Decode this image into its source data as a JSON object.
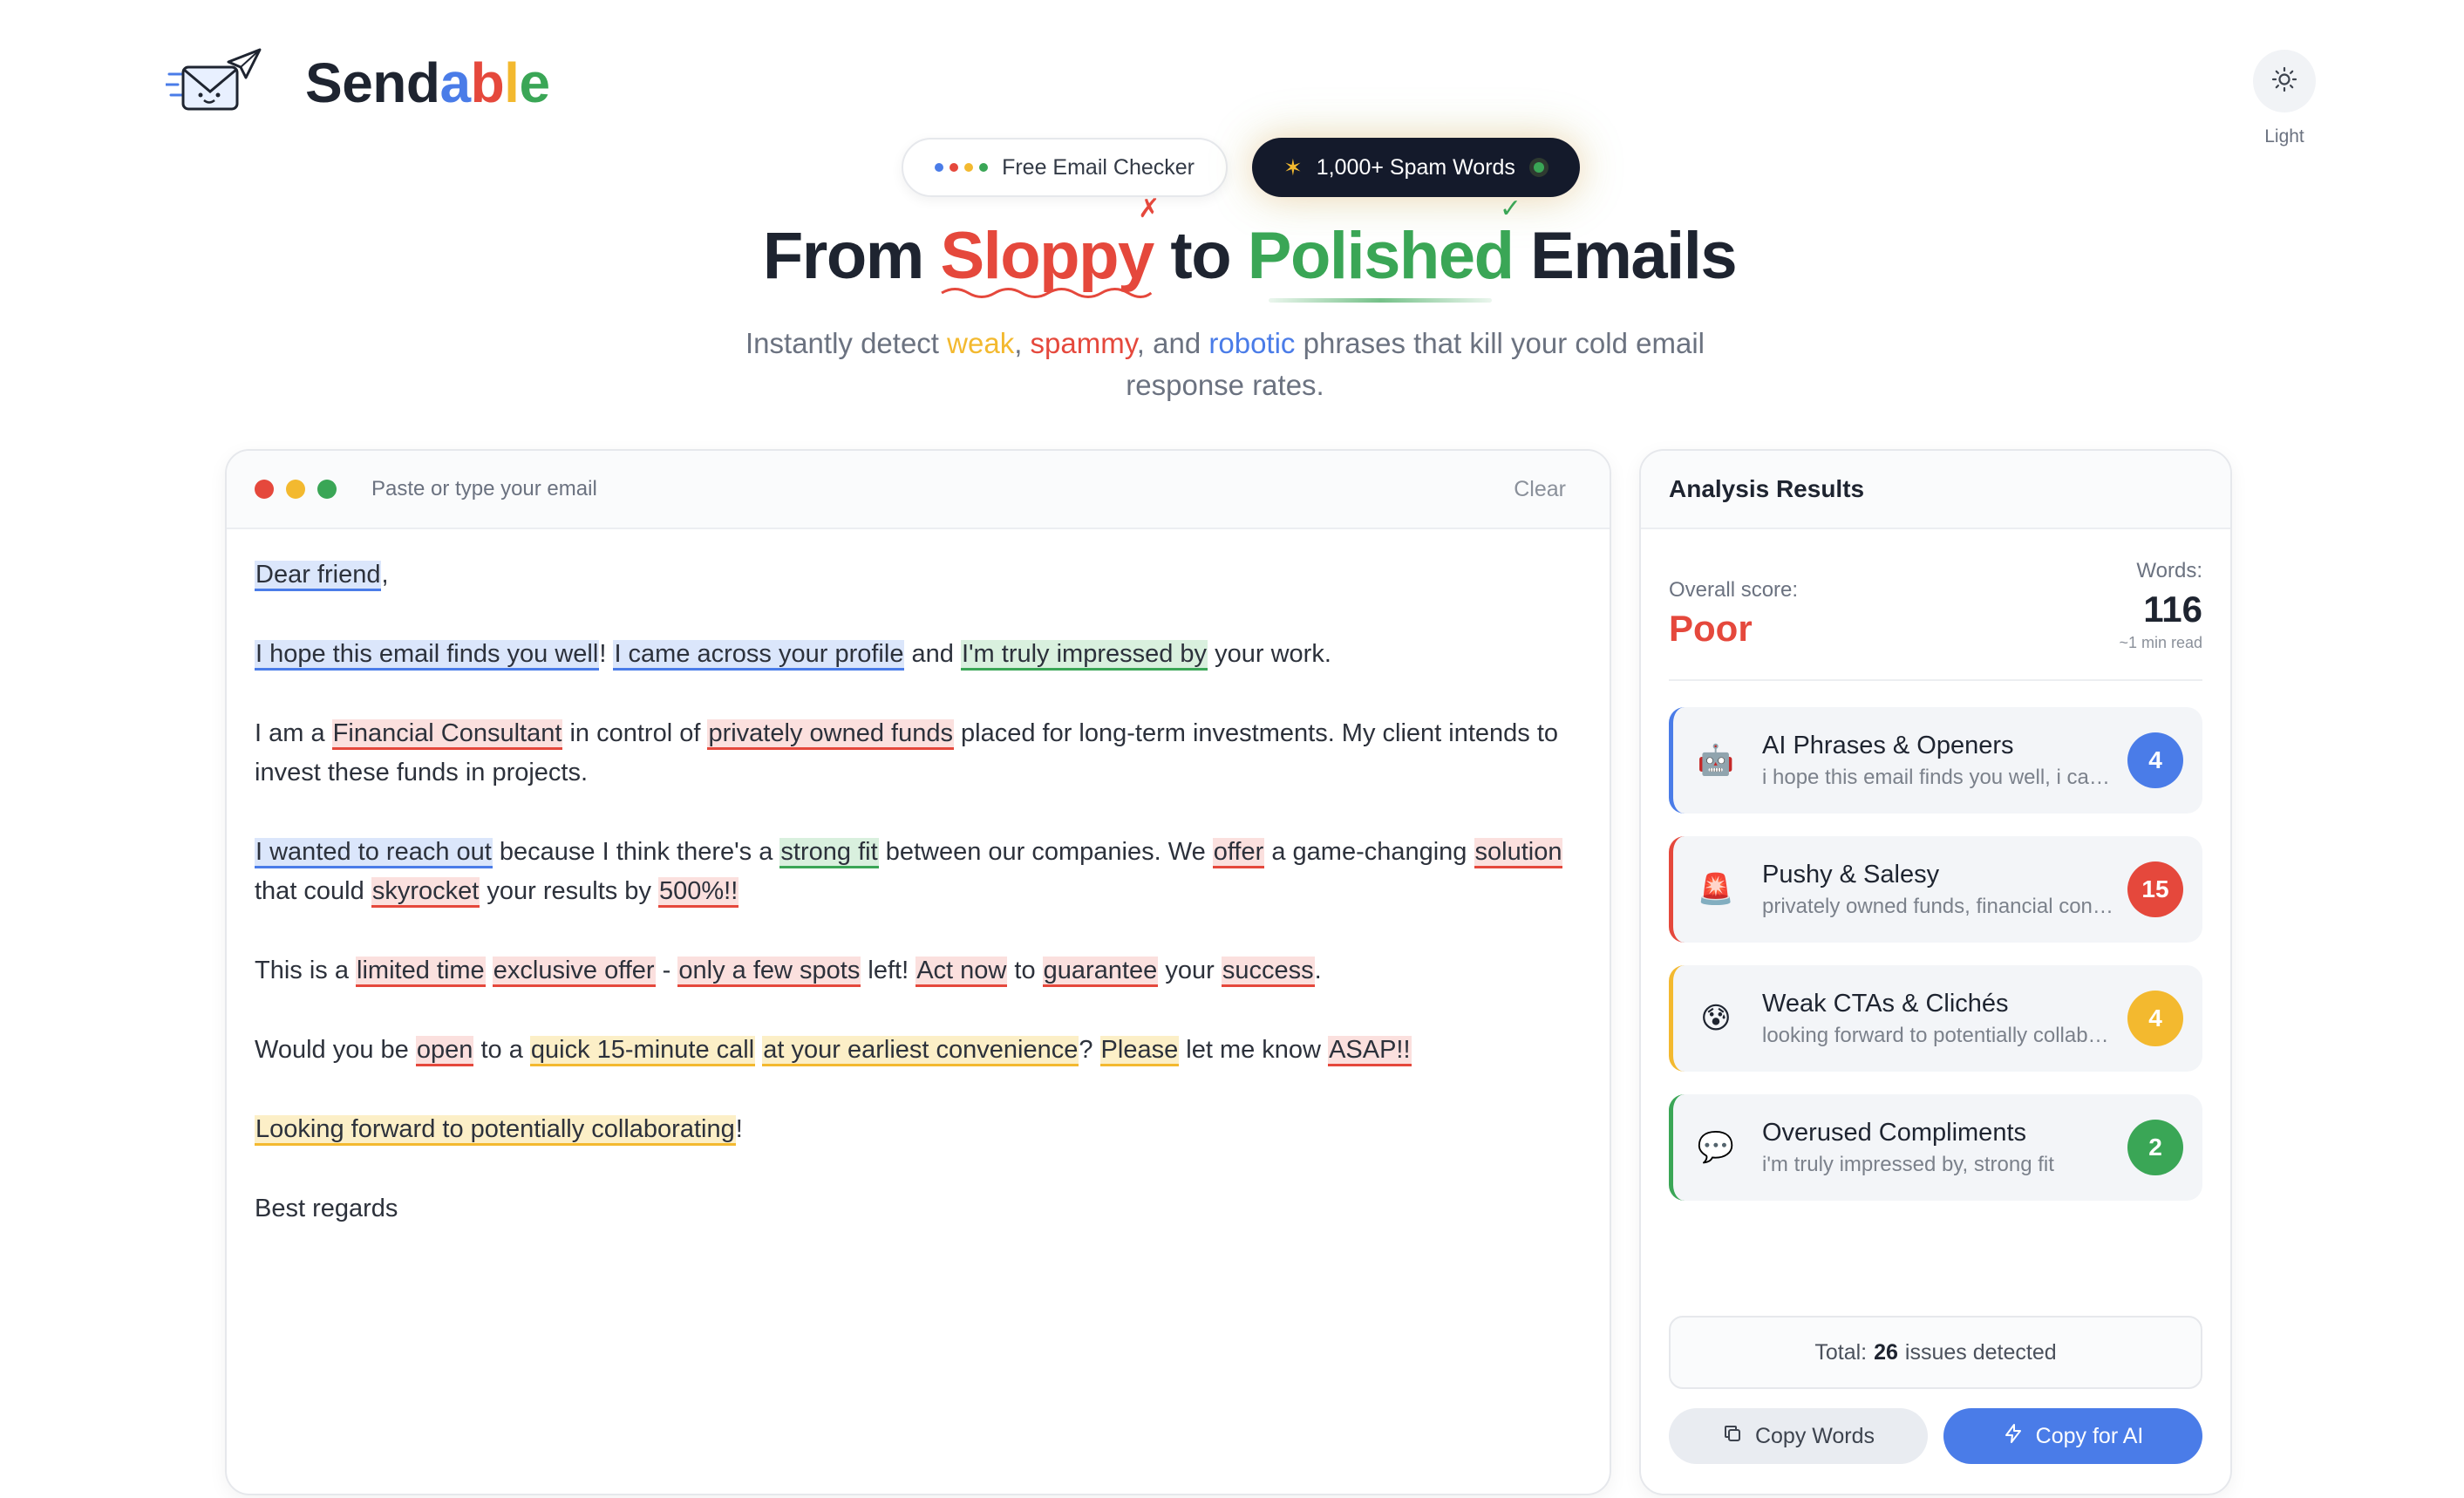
{
  "brand": {
    "part1": "Send",
    "a": "a",
    "b": "b",
    "l": "l",
    "e": "e"
  },
  "theme": {
    "label": "Light"
  },
  "pills": {
    "free_checker": "Free Email Checker",
    "spam_words": "1,000+ Spam Words",
    "spam_star": "✶"
  },
  "hero": {
    "from": "From",
    "sloppy": "Sloppy",
    "to": "to",
    "polished": "Polished",
    "emails": "Emails",
    "sub_1": "Instantly detect",
    "weak": "weak",
    "comma": ",",
    "spammy": "spammy",
    "and": ", and",
    "robotic": "robotic",
    "sub_2": "phrases that kill your cold email response rates."
  },
  "editor": {
    "placeholder": "Paste or type your email",
    "clear_label": "Clear",
    "p1": {
      "t1": "Dear friend",
      "t2": ","
    },
    "p2": {
      "t1": "I hope this email finds you well",
      "t2": "! ",
      "t3": "I came across your profile",
      "t4": " and ",
      "t5": "I'm truly impressed by",
      "t6": " your work."
    },
    "p3": {
      "t1": "I am a ",
      "t2": "Financial Consultant",
      "t3": " in control of ",
      "t4": "privately owned funds",
      "t5": " placed for long-term investments. My client intends to invest these funds in projects."
    },
    "p4": {
      "t1": "I wanted to reach out",
      "t2": " because I think there's a ",
      "t3": "strong fit",
      "t4": " between our companies. We ",
      "t5": "offer",
      "t6": " a game-changing ",
      "t7": "solution",
      "t8": " that could ",
      "t9": "skyrocket",
      "t10": " your results by ",
      "t11": "500%!!"
    },
    "p5": {
      "t1": "This is a ",
      "t2": "limited time",
      "t3": " ",
      "t4": "exclusive offer",
      "t5": " - ",
      "t6": "only a few spots",
      "t7": " left! ",
      "t8": "Act now",
      "t9": " to ",
      "t10": "guarantee",
      "t11": " your ",
      "t12": "success",
      "t13": "."
    },
    "p6": {
      "t1": "Would you be ",
      "t2": "open",
      "t3": " to a ",
      "t4": "quick 15-minute call",
      "t5": " ",
      "t6": "at your earliest convenience",
      "t7": "? ",
      "t8": "Please",
      "t9": " let me know ",
      "t10": "ASAP!!"
    },
    "p7": {
      "t1": "Looking forward to potentially collaborating",
      "t2": "!"
    },
    "p8": {
      "t1": "Best regards"
    }
  },
  "results": {
    "title": "Analysis Results",
    "score_label": "Overall score:",
    "score_value": "Poor",
    "words_label": "Words:",
    "words_value": "116",
    "read_time": "~1 min read",
    "categories": [
      {
        "icon": "🤖",
        "title": "AI Phrases & Openers",
        "sub": "i hope this email finds you well, i came across your profile, i wanted to reach out",
        "count": "4",
        "color": "#4a7ce8"
      },
      {
        "icon": "🚨",
        "title": "Pushy & Salesy",
        "sub": "privately owned funds, financial consultant, offer",
        "count": "15",
        "color": "#e5483c"
      },
      {
        "icon": "😰",
        "title": "Weak CTAs & Clichés",
        "sub": "looking forward to potentially collaborating, please",
        "count": "4",
        "color": "#f3b92f"
      },
      {
        "icon": "💬",
        "title": "Overused Compliments",
        "sub": "i'm truly impressed by, strong fit",
        "count": "2",
        "color": "#3aa656"
      }
    ],
    "total_prefix": "Total:",
    "total_count": "26",
    "total_suffix": "issues detected",
    "copy_words": "Copy Words",
    "copy_ai": "Copy for AI"
  }
}
